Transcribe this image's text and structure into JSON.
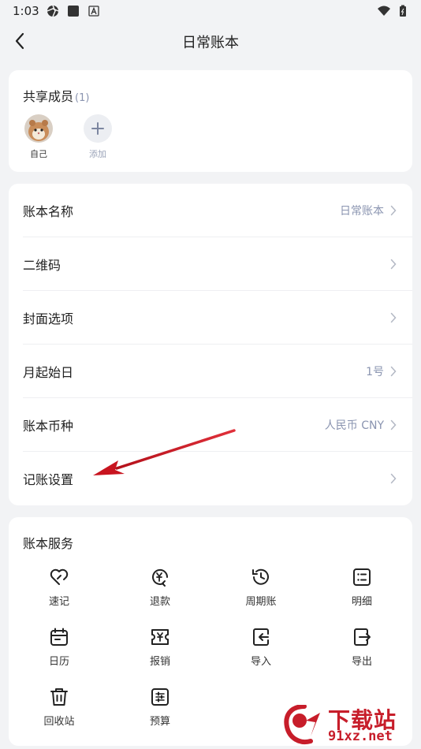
{
  "status_bar": {
    "time": "1:03"
  },
  "nav": {
    "title": "日常账本"
  },
  "members": {
    "title": "共享成员",
    "count": "(1)",
    "items": [
      {
        "label": "自己"
      },
      {
        "label": "添加"
      }
    ]
  },
  "settings": {
    "rows": [
      {
        "label": "账本名称",
        "value": "日常账本"
      },
      {
        "label": "二维码",
        "value": ""
      },
      {
        "label": "封面选项",
        "value": ""
      },
      {
        "label": "月起始日",
        "value": "1号"
      },
      {
        "label": "账本币种",
        "value": "人民币 CNY"
      },
      {
        "label": "记账设置",
        "value": ""
      }
    ]
  },
  "services": {
    "title": "账本服务",
    "items": [
      {
        "label": "速记",
        "icon": "heart-edit-icon"
      },
      {
        "label": "退款",
        "icon": "yen-refund-icon"
      },
      {
        "label": "周期账",
        "icon": "clock-history-icon"
      },
      {
        "label": "明细",
        "icon": "list-icon"
      },
      {
        "label": "日历",
        "icon": "calendar-icon"
      },
      {
        "label": "报销",
        "icon": "yen-ticket-icon"
      },
      {
        "label": "导入",
        "icon": "import-icon"
      },
      {
        "label": "导出",
        "icon": "export-icon"
      },
      {
        "label": "回收站",
        "icon": "trash-icon"
      },
      {
        "label": "预算",
        "icon": "sliders-icon"
      }
    ]
  },
  "watermark": {
    "text": "下载站",
    "url": "91xz.net"
  },
  "colors": {
    "accent_muted": "#8a94b0",
    "arrow": "#d32027",
    "watermark": "#c71d2a"
  }
}
